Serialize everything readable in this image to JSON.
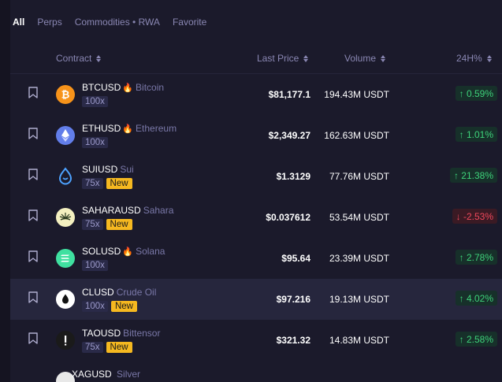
{
  "filters": [
    "All",
    "Perps",
    "Commodities • RWA",
    "Favorite"
  ],
  "headers": {
    "contract": "Contract",
    "last_price": "Last Price",
    "volume": "Volume",
    "change": "24H%"
  },
  "rows": [
    {
      "symbol": "BTCUSD",
      "hot": true,
      "name": "Bitcoin",
      "leverage": "100x",
      "new": "",
      "price": "$81,177.1",
      "volume": "194.43M USDT",
      "change": "↑ 0.59%",
      "direction": "up",
      "icon": "bitcoin-icon",
      "color": "#f7931a"
    },
    {
      "symbol": "ETHUSD",
      "hot": true,
      "name": "Ethereum",
      "leverage": "100x",
      "new": "",
      "price": "$2,349.27",
      "volume": "162.63M USDT",
      "change": "↑ 1.01%",
      "direction": "up",
      "icon": "ethereum-icon",
      "color": "#627eea"
    },
    {
      "symbol": "SUIUSD",
      "hot": false,
      "name": "Sui",
      "leverage": "75x",
      "new": "New",
      "price": "$1.3129",
      "volume": "77.76M USDT",
      "change": "↑ 21.38%",
      "direction": "up",
      "icon": "sui-icon",
      "color": "#4da2ff"
    },
    {
      "symbol": "SAHARAUSD",
      "hot": false,
      "name": "Sahara",
      "leverage": "75x",
      "new": "New",
      "price": "$0.037612",
      "volume": "53.54M USDT",
      "change": "↓ -2.53%",
      "direction": "down",
      "icon": "sahara-icon",
      "color": "#f4f0c0"
    },
    {
      "symbol": "SOLUSD",
      "hot": true,
      "name": "Solana",
      "leverage": "100x",
      "new": "",
      "price": "$95.64",
      "volume": "23.39M USDT",
      "change": "↑ 2.78%",
      "direction": "up",
      "icon": "solana-icon",
      "color": "#3fe0a0"
    },
    {
      "symbol": "CLUSD",
      "hot": false,
      "name": "Crude Oil",
      "leverage": "100x",
      "new": "New",
      "price": "$97.216",
      "volume": "19.13M USDT",
      "change": "↑ 4.02%",
      "direction": "up",
      "icon": "oil-drop-icon",
      "color": "#ffffff"
    },
    {
      "symbol": "TAOUSD",
      "hot": false,
      "name": "Bittensor",
      "leverage": "75x",
      "new": "New",
      "price": "$321.32",
      "volume": "14.83M USDT",
      "change": "↑ 2.58%",
      "direction": "up",
      "icon": "bittensor-icon",
      "color": "#1a1a1a"
    }
  ],
  "cut_row": {
    "symbol": "XAGUSD",
    "name": "Silver"
  }
}
